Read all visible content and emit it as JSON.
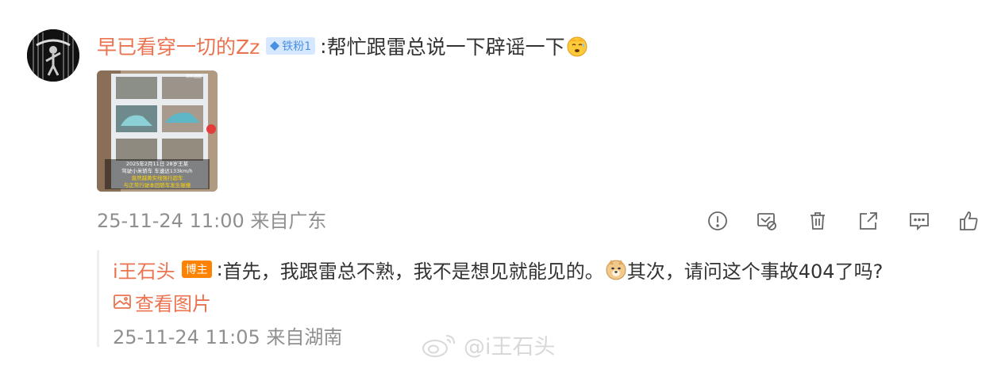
{
  "comment": {
    "username": "早已看穿一切的Zz",
    "fan_badge": "铁粉1",
    "colon": ":",
    "text": "帮忙跟雷总说一下辟谣一下",
    "emoji_icon": "sweat-emoji",
    "thumbnail": {
      "corner_label": "资料画面",
      "caption_line1": "2025年2月11日 28岁王某",
      "caption_line2": "驾驶小米轿车 车速达133km/h",
      "caption_line3": "竟然越黄实线强行超车",
      "caption_line4": "与正常行驶本田轿车发生碰撞"
    },
    "timestamp": "25-11-24 11:00",
    "source": "来自广东"
  },
  "actions": {
    "icons": [
      "alert-icon",
      "forward-block-icon",
      "trash-icon",
      "share-icon",
      "comment-icon",
      "like-icon"
    ]
  },
  "reply": {
    "username": "i王石头",
    "host_badge": "博主",
    "colon": ":",
    "text_part1": "首先，我跟雷总不熟，我不是想见就能见的。",
    "emoji_icon": "doge-emoji",
    "text_part2": "其次，请问这个事故404了吗?",
    "view_picture_label": "查看图片",
    "timestamp": "25-11-24 11:05",
    "source": "来自湖南"
  },
  "watermark": {
    "text": "@i王石头"
  },
  "colors": {
    "username": "#eb7350",
    "meta": "#8f8f8f",
    "fan_badge_bg": "#d6e8ff",
    "host_badge_bg": "#ff8200"
  }
}
